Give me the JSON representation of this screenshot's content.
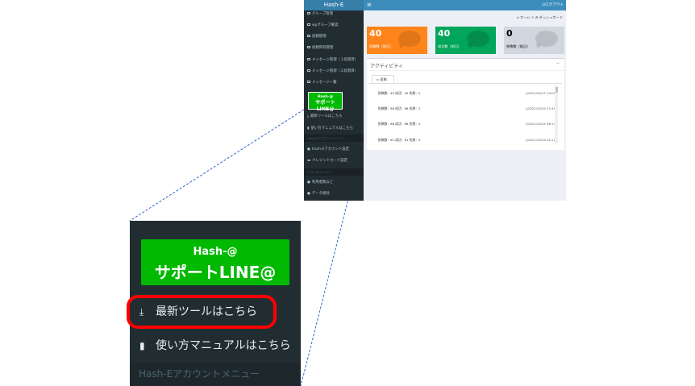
{
  "app": {
    "brand": "Hash-E",
    "menu_toggle": "≡",
    "logout": "ログアウト",
    "breadcrumb_home": "ホーム",
    "breadcrumb_sep": ">",
    "breadcrumb_current": "ダッシュボード"
  },
  "sidebar": {
    "items": [
      {
        "label": "グループ管理"
      },
      {
        "label": "wpグループ確認"
      },
      {
        "label": "投稿管理"
      },
      {
        "label": "投稿時刻管理"
      },
      {
        "label": "メッセージ管理（１段階目）"
      },
      {
        "label": "メッセージ管理（２段階目）"
      },
      {
        "label": "メッセージ一覧"
      }
    ],
    "support_line_top": "Hash-@",
    "support_line_bottom": "サポートLINE@",
    "tool_link": "最新ツールはこちら",
    "manual_link": "使い方マニュアルはこちら",
    "account_header": "Hash-Eアカウントメニュー",
    "account_settings": "Hash-Eアカウント設定",
    "credit_card": "クレジットカード設定",
    "system_header": "システムメニュー",
    "usage": "利用者数など",
    "data_delete": "データ削除"
  },
  "stats": {
    "posts_value": "40",
    "posts_label": "投稿数（前日）",
    "success_value": "40",
    "success_label": "成功数（前日）",
    "fail_value": "0",
    "fail_label": "失敗数（前日）"
  },
  "activity": {
    "title": "アクティビティ",
    "collapse": "−",
    "tab": "投稿",
    "rows": [
      {
        "text": "投稿数：40 成功：40 失敗：0",
        "date": "2021/10/17 14:05"
      },
      {
        "text": "投稿数：66 成功：66 失敗：2",
        "date": "2021/10/24 22:40"
      },
      {
        "text": "投稿数：66 成功：66 失敗：0",
        "date": "2021/10/24 08:14"
      },
      {
        "text": "投稿数：61 成功：61 失敗：0",
        "date": "2021/10/24 02:12"
      }
    ]
  },
  "zoom": {
    "support_line_top": "Hash-@",
    "support_line_bottom": "サポートLINE@",
    "tool_link": "最新ツールはこちら",
    "manual_link": "使い方マニュアルはこちら",
    "account_header": "Hash-Eアカウントメニュー"
  },
  "colors": {
    "sidebar_bg": "#222d32",
    "topbar": "#3c8dbc",
    "posts_box": "#ff851b",
    "success_box": "#00a65a",
    "fail_box": "#d2d6de",
    "line_green": "#00b900",
    "highlight": "#ff0000"
  }
}
